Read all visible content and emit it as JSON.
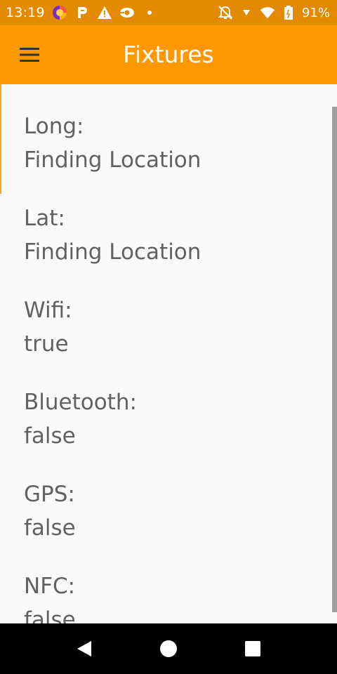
{
  "status_bar": {
    "time": "13:19",
    "battery_percent": "91%",
    "left_icons": [
      "firefox-icon",
      "p-app-icon",
      "warning-icon",
      "link-icon",
      "dot-icon"
    ],
    "right_icons": [
      "notifications-off-icon",
      "signal-icon",
      "wifi-icon",
      "battery-icon"
    ]
  },
  "app_bar": {
    "title": "Fixtures",
    "menu_icon": "hamburger-menu-icon",
    "background_color": "#ff9800"
  },
  "fields": [
    {
      "label": "Long:",
      "value": "Finding Location"
    },
    {
      "label": "Lat:",
      "value": "Finding Location"
    },
    {
      "label": "Wifi:",
      "value": "true"
    },
    {
      "label": "Bluetooth:",
      "value": "false"
    },
    {
      "label": "GPS:",
      "value": "false"
    },
    {
      "label": "NFC:",
      "value": "false"
    }
  ],
  "nav_bar": {
    "back_icon": "back-triangle-icon",
    "home_icon": "home-circle-icon",
    "recents_icon": "recents-square-icon"
  }
}
